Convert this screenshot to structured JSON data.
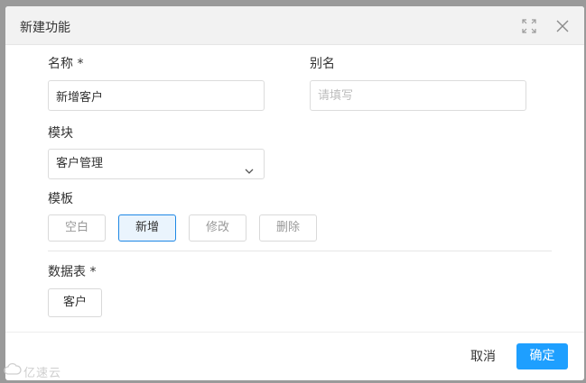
{
  "dialog": {
    "title": "新建功能",
    "maximize_icon": "maximize-icon",
    "close_icon": "close-icon"
  },
  "form": {
    "name_label": "名称 *",
    "name_value": "新增客户",
    "alias_label": "别名",
    "alias_placeholder": "请填写",
    "module_label": "模块",
    "module_value": "客户管理",
    "template_label": "模板",
    "templates": [
      "空白",
      "新增",
      "修改",
      "删除"
    ],
    "selected_template": "新增",
    "table_label": "数据表 *",
    "table_value": "客户"
  },
  "footer": {
    "cancel_label": "取消",
    "ok_label": "确定"
  },
  "watermark": {
    "text": "亿速云"
  },
  "colors": {
    "primary": "#1e9fff",
    "selected_border": "#1e88e5",
    "header_bg": "#f2f2f2",
    "overlay": "#9a9a9a"
  }
}
